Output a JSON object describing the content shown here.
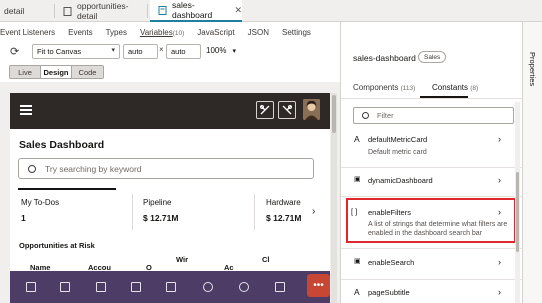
{
  "file_tabs": [
    {
      "label": "detail"
    },
    {
      "label": "opportunities-detail"
    },
    {
      "label": "sales-dashboard",
      "active": true
    }
  ],
  "sub_tabs": [
    {
      "label": "Event Listeners"
    },
    {
      "label": "Events"
    },
    {
      "label": "Types"
    },
    {
      "label": "Variables",
      "count": "(10)"
    },
    {
      "label": "JavaScript"
    },
    {
      "label": "JSON"
    },
    {
      "label": "Settings"
    }
  ],
  "toolbar": {
    "fit_value": "Fit to Canvas",
    "width_value": "auto",
    "times": "×",
    "height_value": "auto",
    "zoom": "100%"
  },
  "modes": [
    {
      "label": "Live"
    },
    {
      "label": "Design",
      "active": true
    },
    {
      "label": "Code"
    }
  ],
  "app": {
    "title": "Sales Dashboard",
    "search_placeholder": "Try searching by keyword",
    "cards": [
      {
        "label": "My To-Dos",
        "value": "1"
      },
      {
        "label": "Pipeline",
        "value": "$ 12.71M"
      },
      {
        "label": "Hardware",
        "value": "$ 12.71M"
      }
    ],
    "risk_title": "Opportunities at Risk",
    "column_heads": [
      "Name",
      "Accou",
      "O",
      "Wir",
      "Ac",
      "Cl"
    ]
  },
  "panel": {
    "component_name": "sales-dashboard",
    "badge": "Sales",
    "tabs": [
      {
        "label": "Components",
        "count": "(113)"
      },
      {
        "label": "Constants",
        "count": "(8)",
        "active": true
      }
    ],
    "filter_placeholder": "Filter",
    "items": [
      {
        "type_icon": "A",
        "name": "defaultMetricCard",
        "desc": "Default metric card"
      },
      {
        "type_icon": "▣",
        "name": "dynamicDashboard",
        "desc": ""
      },
      {
        "type_icon": "[ ]",
        "name": "enableFilters",
        "desc": "A list of strings that determine what filters are enabled in the dashboard search bar"
      },
      {
        "type_icon": "▣",
        "name": "enableSearch",
        "desc": ""
      },
      {
        "type_icon": "A",
        "name": "pageSubtitle",
        "desc": ""
      }
    ],
    "side_label": "Properties"
  },
  "colors": {
    "accent": "#227e9e",
    "appbar": "#2e2926",
    "tabbar": "#4d3d66",
    "fab": "#c74634",
    "highlight": "#e0272d"
  }
}
